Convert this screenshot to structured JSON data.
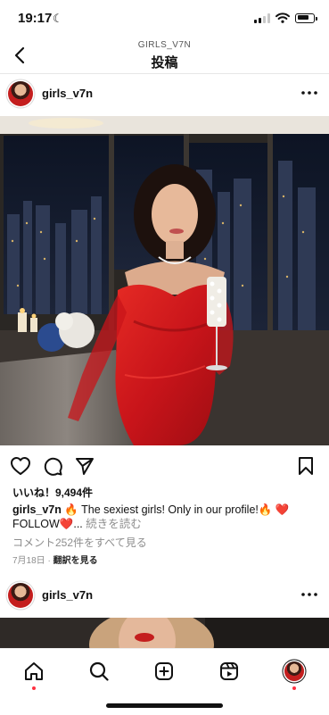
{
  "status": {
    "time": "19:17",
    "battery_level": 0.8
  },
  "header": {
    "subtitle": "GIRLS_V7N",
    "title": "投稿"
  },
  "post": {
    "username": "girls_v7n",
    "likes": "いいね！9,494件",
    "caption_user": "girls_v7n",
    "caption_text": " 🔥 The sexiest girls! Only in our profile!🔥 ❤️ FOLLOW❤️...",
    "caption_more": " 続きを読む",
    "view_comments": "コメント252件をすべて見る",
    "date": "7月18日",
    "separator": " · ",
    "translate": "翻訳を見る"
  },
  "next_post": {
    "username": "girls_v7n"
  },
  "icons": {
    "back": "chevron-left-icon",
    "more": "more-horizontal-icon",
    "like": "heart-icon",
    "comment": "comment-icon",
    "share": "paper-plane-icon",
    "save": "bookmark-icon",
    "home": "home-icon",
    "search": "search-icon",
    "create": "plus-square-icon",
    "reels": "reels-icon",
    "profile": "profile-avatar"
  },
  "colors": {
    "notification_dot": "#ff3040",
    "dress": "#d31f1f"
  }
}
